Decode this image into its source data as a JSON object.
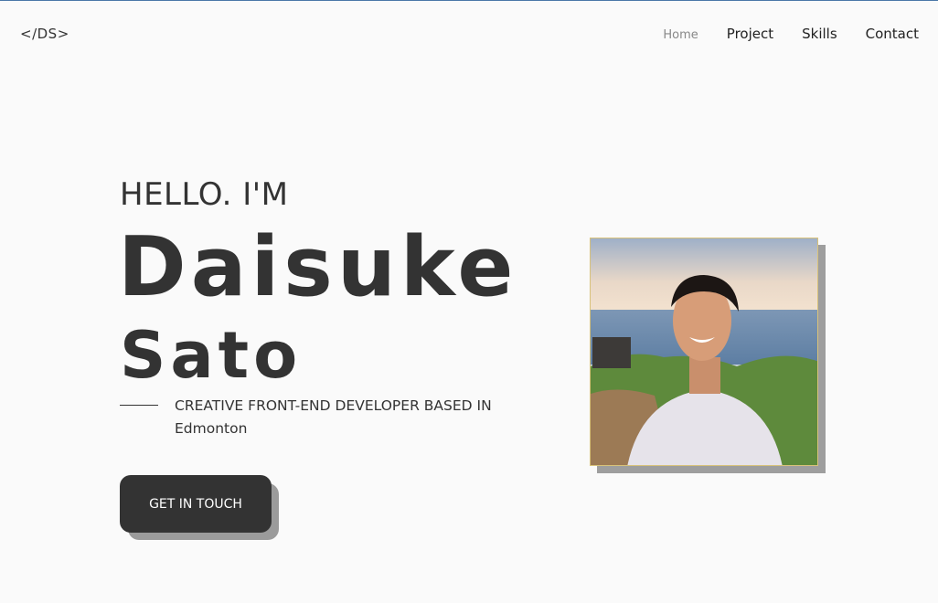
{
  "header": {
    "logo": "</DS>",
    "nav": [
      {
        "label": "Home",
        "active": true
      },
      {
        "label": "Project",
        "active": false
      },
      {
        "label": "Skills",
        "active": false
      },
      {
        "label": "Contact",
        "active": false
      }
    ]
  },
  "hero": {
    "greeting": "HELLO. I'M",
    "first_name": "Daisuke",
    "last_name": "Sato",
    "tagline": "CREATIVE FRONT-END DEVELOPER BASED IN Edmonton",
    "cta_label": "GET IN TOUCH"
  },
  "colors": {
    "background": "#fafafa",
    "text": "#333333",
    "button_bg": "#333333",
    "shadow": "#9e9e9e",
    "photo_border": "#d8c27a"
  }
}
